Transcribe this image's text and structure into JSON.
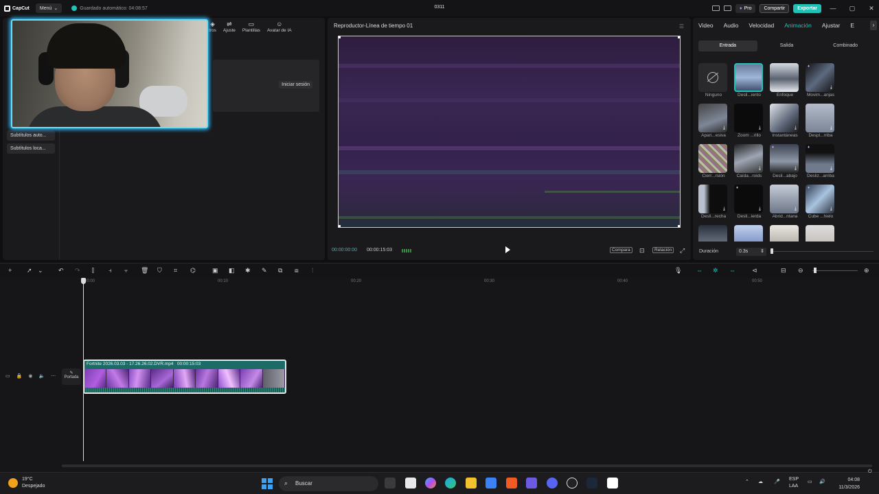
{
  "titlebar": {
    "app_name": "CapCut",
    "menu_label": "Menú",
    "autosave": "Guardado automático: 04:08:57",
    "project_name": "0311",
    "pro_label": "Pro",
    "share_label": "Compartir",
    "export_label": "Exportar"
  },
  "left_panel": {
    "nav": [
      {
        "label": "tros",
        "icon": "filters-icon"
      },
      {
        "label": "Ajuste",
        "icon": "adjust-icon"
      },
      {
        "label": "Plantillas",
        "icon": "templates-icon"
      },
      {
        "label": "Avatar de IA",
        "icon": "ai-avatar-icon"
      }
    ],
    "login_button": "Iniciar sesión",
    "sidebar_items": [
      "Subtítulos auto...",
      "Subtítulos loca..."
    ]
  },
  "player": {
    "title": "Reproductor-Línea de tiempo 01",
    "current_time": "00:00:00:00",
    "total_time": "00:00:15:03",
    "compare_label": "Compara",
    "ratio_label": "Relación"
  },
  "right_panel": {
    "tabs": [
      "Video",
      "Audio",
      "Velocidad",
      "Animación",
      "Ajustar",
      "E"
    ],
    "active_tab": "Animación",
    "subtabs": [
      "Entrada",
      "Salida",
      "Combinado"
    ],
    "active_subtab": "Entrada",
    "animations": [
      {
        "label": "Ninguno"
      },
      {
        "label": "Desli...iento"
      },
      {
        "label": "Enfoque"
      },
      {
        "label": "Movim...anjas"
      },
      {
        "label": "Apari...esiva"
      },
      {
        "label": "Zoom ...rillo"
      },
      {
        "label": "Instantáneas"
      },
      {
        "label": "Despl...rriba"
      },
      {
        "label": "Cierr...rsión"
      },
      {
        "label": "Caída...roids"
      },
      {
        "label": "Desli...abajo"
      },
      {
        "label": "Desliz...arriba"
      },
      {
        "label": "Desli...recha"
      },
      {
        "label": "Desli...ierda"
      },
      {
        "label": "Abrid...ntana"
      },
      {
        "label": "Cube ...hielo"
      },
      {
        "label": ""
      },
      {
        "label": ""
      },
      {
        "label": ""
      },
      {
        "label": ""
      }
    ],
    "selected_index": 1,
    "duration_label": "Duración",
    "duration_value": "0.3s"
  },
  "timeline": {
    "ruler_labels": [
      "00:00",
      "00:10",
      "00:20",
      "00:30",
      "00:40",
      "00:50"
    ],
    "clip_name": "Fortnite 2026.03.03 - 17.26.26.02.DVR.mp4",
    "clip_duration": "00:00:15:03",
    "cover_label": "Portada"
  },
  "taskbar": {
    "temperature": "19°C",
    "weather": "Despejado",
    "search_label": "Buscar",
    "language": "ESP",
    "layout": "LAA",
    "time": "04:08",
    "date": "11/3/2026"
  }
}
